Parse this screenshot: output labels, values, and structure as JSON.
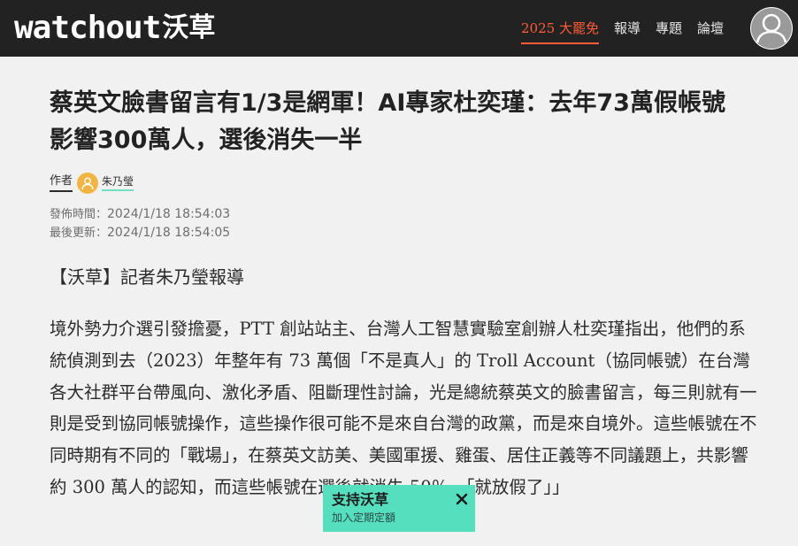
{
  "header": {
    "logo_en": "watchout",
    "logo_zh": "沃草",
    "nav": [
      {
        "label": "2025 大罷免",
        "active": true
      },
      {
        "label": "報導",
        "active": false
      },
      {
        "label": "專題",
        "active": false
      },
      {
        "label": "論壇",
        "active": false
      }
    ]
  },
  "article": {
    "title": "蔡英文臉書留言有1/3是網軍！AI專家杜奕瑾：去年73萬假帳號影響300萬人，選後消失一半",
    "author_label": "作者",
    "author_name": "朱乃瑩",
    "published_label": "發佈時間：",
    "published": "2024/1/18 18:54:03",
    "updated_label": "最後更新：",
    "updated": "2024/1/18 18:54:05",
    "lead": "【沃草】記者朱乃瑩報導",
    "body": "境外勢力介選引發擔憂，PTT 創站站主、台灣人工智慧實驗室創辦人杜奕瑾指出，他們的系統偵測到去（2023）年整年有 73 萬個「不是真人」的 Troll Account（協同帳號）在台灣各大社群平台帶風向、激化矛盾、阻斷理性討論，光是總統蔡英文的臉書留言，每三則就有一則是受到協同帳號操作，這些操作很可能不是來自台灣的政黨，而是來自境外。這些帳號在不同時期有不同的「戰場」，在蔡英文訪美、美國軍援、雞蛋、居住正義等不同議題上，共影響約 300 萬人的認知，而這些帳號在選後就消失 50％，「就放假了」」"
  },
  "cta": {
    "title": "支持沃草",
    "subtitle": "加入定期定額"
  },
  "colors": {
    "header_bg": "#222222",
    "accent": "#ff5c35",
    "cta_bg": "#55dfbf",
    "author_underline": "#6fe0c4",
    "page_bg": "#f1f1f1"
  },
  "icons": {
    "user": "user-avatar-icon",
    "author": "person-icon",
    "close": "close-icon"
  }
}
